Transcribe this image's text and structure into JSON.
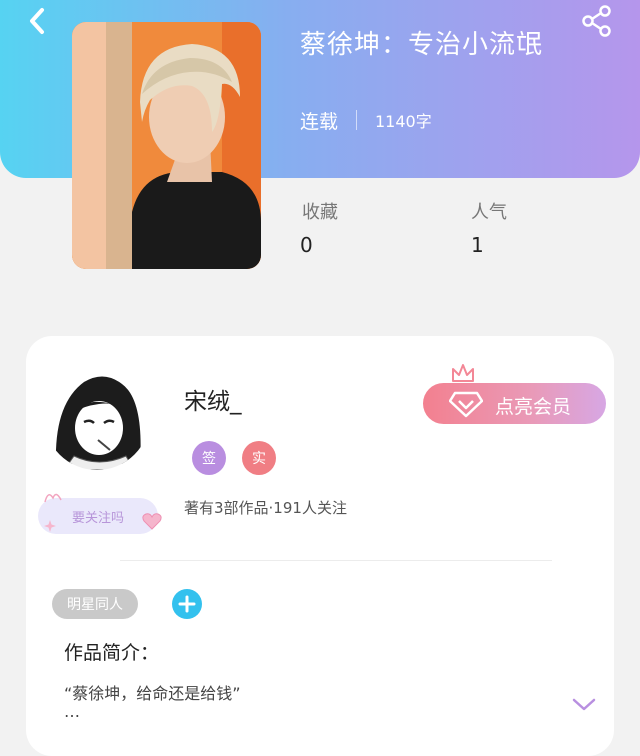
{
  "header": {
    "title": "蔡徐坤：专治小流氓",
    "status": "连载",
    "word_count": "1140字",
    "gradient": [
      "#56d3f2",
      "#b596ec"
    ]
  },
  "stats": {
    "favorites_label": "收藏",
    "favorites_value": "0",
    "popularity_label": "人气",
    "popularity_value": "1"
  },
  "author": {
    "name": "宋绒_",
    "badges": [
      {
        "label": "签",
        "color": "#b98ee0"
      },
      {
        "label": "实",
        "color": "#f07e84"
      }
    ],
    "info": "著有3部作品·191人关注",
    "follow_label": "要关注吗"
  },
  "membership": {
    "button_label": "点亮会员",
    "colors": [
      "#f3808f",
      "#d7a7e4"
    ]
  },
  "tags": {
    "items": [
      "明星同人"
    ],
    "add_icon": "plus-icon",
    "add_color": "#33c1ee"
  },
  "intro": {
    "heading": "作品简介：",
    "text": "“蔡徐坤，给命还是给钱”",
    "ellipsis": "…"
  },
  "icons": {
    "back": "chevron-left-icon",
    "share": "share-icon",
    "expand": "chevron-down-icon",
    "crown": "crown-icon",
    "diamond": "diamond-icon"
  }
}
